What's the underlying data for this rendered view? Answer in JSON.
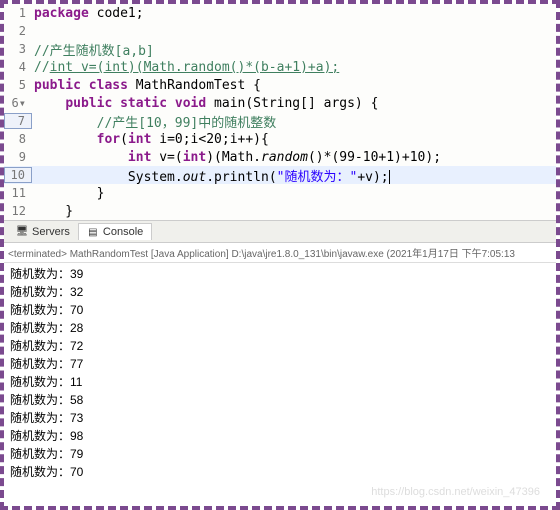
{
  "lines": [
    {
      "num": "1",
      "fold": "",
      "code": [
        {
          "t": "kw",
          "v": "package"
        },
        {
          "t": "",
          "v": " code1;"
        }
      ]
    },
    {
      "num": "2",
      "fold": "",
      "code": []
    },
    {
      "num": "3",
      "fold": "",
      "code": [
        {
          "t": "comment",
          "v": "//产生随机数[a,b]"
        }
      ]
    },
    {
      "num": "4",
      "fold": "",
      "code": [
        {
          "t": "comment",
          "v": "//"
        },
        {
          "t": "comment",
          "v": "int v=(int)(Math.random()*(b-a+1)+a);",
          "u": true
        }
      ]
    },
    {
      "num": "5",
      "fold": "",
      "code": [
        {
          "t": "kw",
          "v": "public"
        },
        {
          "t": "",
          "v": " "
        },
        {
          "t": "kw",
          "v": "class"
        },
        {
          "t": "",
          "v": " MathRandomTest {"
        }
      ]
    },
    {
      "num": "6",
      "fold": "▾",
      "boxed": false,
      "code": [
        {
          "t": "",
          "v": "    "
        },
        {
          "t": "kw",
          "v": "public"
        },
        {
          "t": "",
          "v": " "
        },
        {
          "t": "kw",
          "v": "static"
        },
        {
          "t": "",
          "v": " "
        },
        {
          "t": "kw",
          "v": "void"
        },
        {
          "t": "",
          "v": " main(String[] args) {"
        }
      ]
    },
    {
      "num": "7",
      "boxed": true,
      "code": [
        {
          "t": "",
          "v": "        "
        },
        {
          "t": "comment",
          "v": "//产生[10，99]中的随机整数"
        }
      ]
    },
    {
      "num": "8",
      "code": [
        {
          "t": "",
          "v": "        "
        },
        {
          "t": "kw",
          "v": "for"
        },
        {
          "t": "",
          "v": "("
        },
        {
          "t": "kw",
          "v": "int"
        },
        {
          "t": "",
          "v": " i=0;i<20;i++){"
        }
      ]
    },
    {
      "num": "9",
      "code": [
        {
          "t": "",
          "v": "            "
        },
        {
          "t": "kw",
          "v": "int"
        },
        {
          "t": "",
          "v": " v=("
        },
        {
          "t": "kw",
          "v": "int"
        },
        {
          "t": "",
          "v": ")(Math."
        },
        {
          "t": "italic",
          "v": "random"
        },
        {
          "t": "",
          "v": "()*(99-10+1)+10);"
        }
      ]
    },
    {
      "num": "10",
      "boxed": true,
      "highlight": true,
      "cursor": true,
      "code": [
        {
          "t": "",
          "v": "            System."
        },
        {
          "t": "italic",
          "v": "out"
        },
        {
          "t": "",
          "v": ".println("
        },
        {
          "t": "str",
          "v": "\"随机数为："
        },
        {
          "t": "str",
          "v": "\""
        },
        {
          "t": "",
          "v": "+v);"
        }
      ]
    },
    {
      "num": "11",
      "code": [
        {
          "t": "",
          "v": "        }"
        }
      ]
    },
    {
      "num": "12",
      "code": [
        {
          "t": "",
          "v": "    }"
        }
      ]
    }
  ],
  "tabs": {
    "servers": "Servers",
    "console": "Console"
  },
  "status": "<terminated> MathRandomTest [Java Application] D:\\java\\jre1.8.0_131\\bin\\javaw.exe (2021年1月17日 下午7:05:13",
  "console_prefix": "随机数为：",
  "console_values": [
    39,
    32,
    70,
    28,
    72,
    77,
    11,
    58,
    73,
    98,
    79,
    70
  ],
  "watermark": "https://blog.csdn.net/weixin_47396"
}
